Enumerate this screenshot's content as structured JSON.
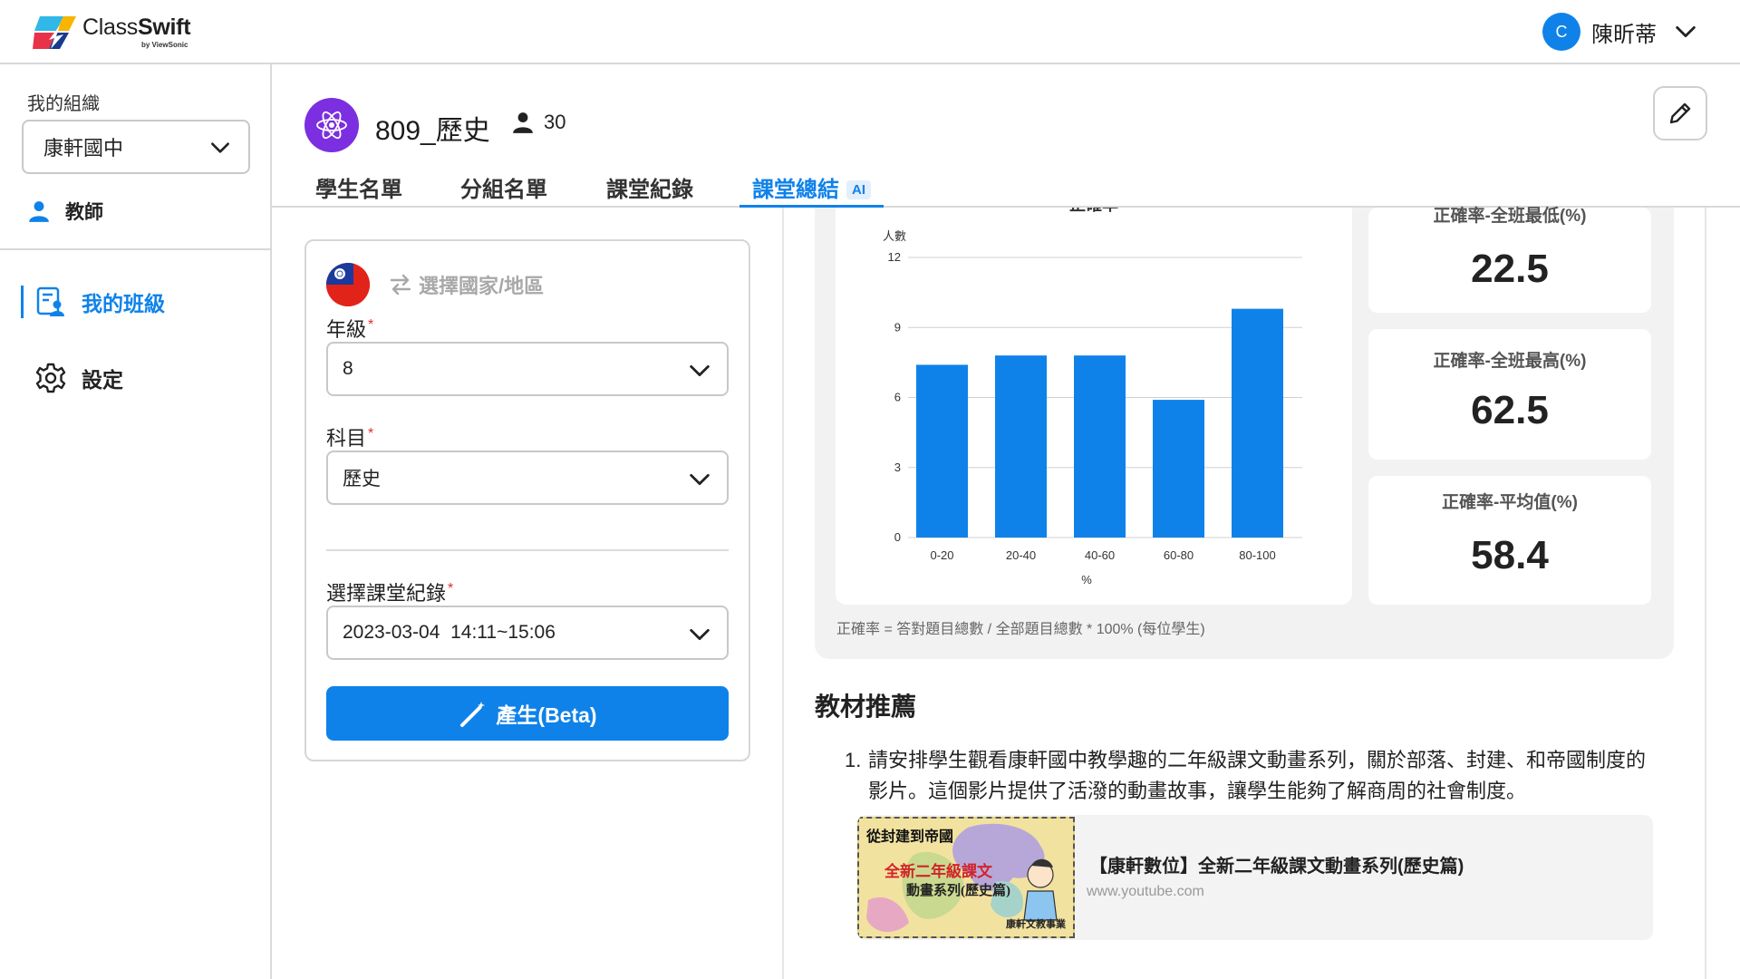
{
  "app": {
    "logo_text_light": "Class",
    "logo_text_bold": "Swift",
    "logo_sub": "by ViewSonic"
  },
  "user": {
    "initial": "C",
    "name": "陳昕蒂"
  },
  "sidebar": {
    "org_label": "我的組織",
    "org_value": "康軒國中",
    "role": "教師",
    "nav": [
      {
        "label": "我的班級",
        "active": true
      },
      {
        "label": "設定",
        "active": false
      }
    ]
  },
  "class": {
    "name": "809_歷史",
    "student_count": "30",
    "tabs": [
      {
        "label": "學生名單"
      },
      {
        "label": "分組名單"
      },
      {
        "label": "課堂紀錄"
      },
      {
        "label": "課堂總結",
        "badge": "AI",
        "active": true
      }
    ]
  },
  "form": {
    "country_placeholder": "選擇國家/地區",
    "grade_label": "年級",
    "grade_value": "8",
    "subject_label": "科目",
    "subject_value": "歷史",
    "record_label": "選擇課堂紀錄",
    "record_value": "2023-03-04  14:11~15:06",
    "required_mark": "*",
    "generate_label": "產生(Beta)"
  },
  "chart_data": {
    "type": "bar",
    "title": "正確率",
    "ylabel": "人數",
    "xlabel": "%",
    "categories": [
      "0-20",
      "20-40",
      "40-60",
      "60-80",
      "80-100"
    ],
    "values": [
      7.4,
      7.8,
      7.8,
      5.9,
      9.8
    ],
    "yticks": [
      0,
      3,
      6,
      9,
      12
    ],
    "ylim": [
      0,
      12
    ],
    "grid": true,
    "color": "#0f82ea"
  },
  "stats": [
    {
      "label": "正確率-全班最低(%)",
      "value": "22.5"
    },
    {
      "label": "正確率-全班最高(%)",
      "value": "62.5"
    },
    {
      "label": "正確率-平均值(%)",
      "value": "58.4"
    }
  ],
  "formula": "正確率 = 答對題目總數 / 全部題目總數 * 100% (每位學生)",
  "recommend": {
    "title": "教材推薦",
    "item_number": "1.",
    "item_text": "請安排學生觀看康軒國中教學趣的二年級課文動畫系列，關於部落、封建、和帝國制度的影片。這個影片提供了活潑的動畫故事，讓學生能夠了解商周的社會制度。",
    "video_title": "【康軒數位】全新二年級課文動畫系列(歷史篇)",
    "video_url": "www.youtube.com",
    "thumb_title": "從封建到帝國",
    "thumb_sub1": "全新二年級課文",
    "thumb_sub2": "動畫系列(歷史篇)",
    "thumb_brand": "康軒文教事業"
  }
}
